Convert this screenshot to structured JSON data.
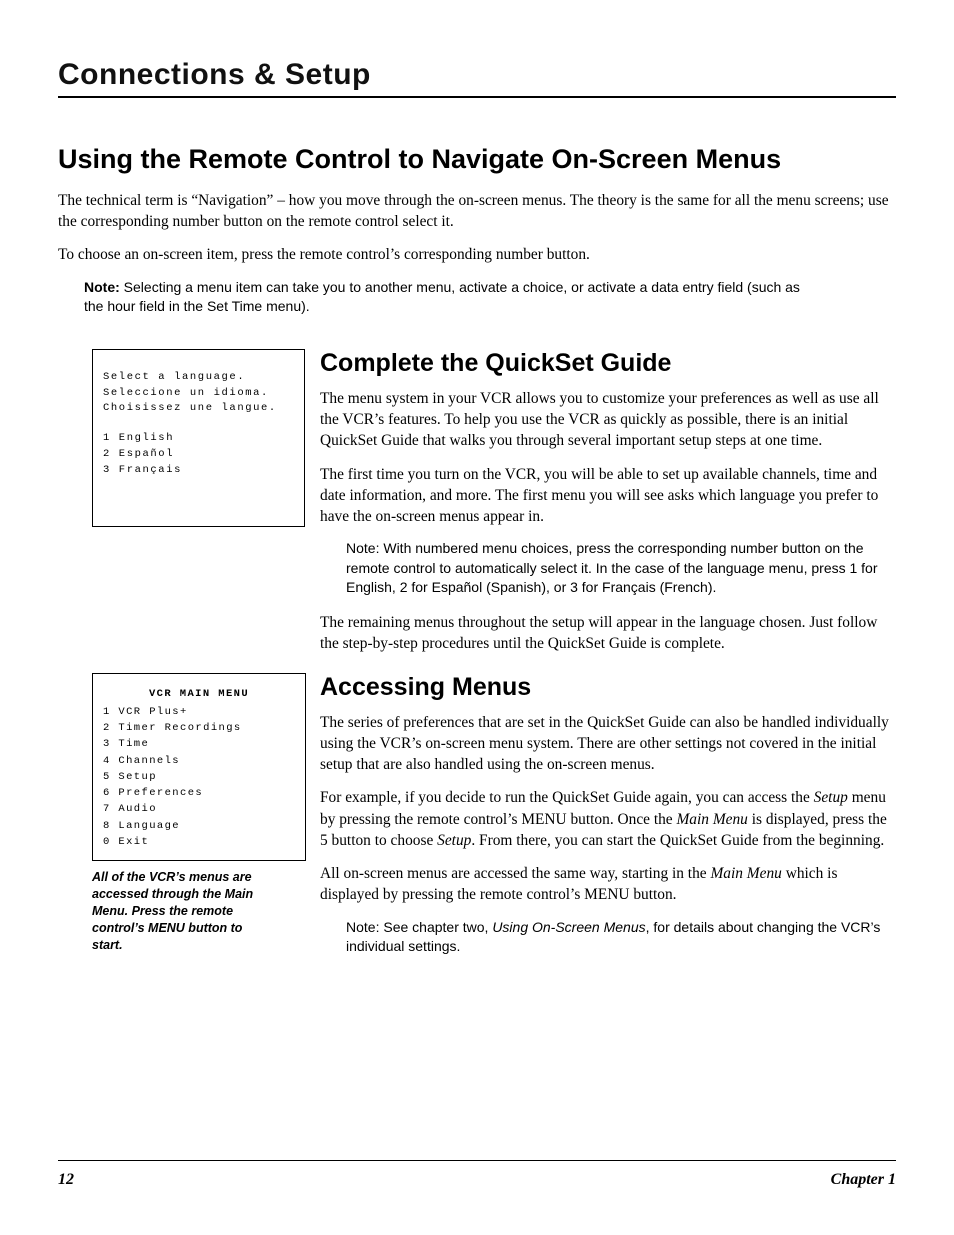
{
  "chapter_title": "Connections & Setup",
  "section1": {
    "title": "Using the Remote Control to Navigate On-Screen Menus",
    "para1": "The technical term is “Navigation” – how you move through the on-screen menus. The theory is the same for all the menu screens; use the corresponding number button on the remote control select it.",
    "para2": "To choose an on-screen item, press the remote control’s corresponding number button.",
    "note_bold": "Note:",
    "note_text": " Selecting a menu item can take you to another menu, activate a choice, or activate a data entry field (such as the hour field in the Set Time menu)."
  },
  "lang_box": {
    "line1": "Select a language.",
    "line2": "Seleccione un idioma.",
    "line3": "Choisissez une langue.",
    "opt1": "1 English",
    "opt2": "2 Español",
    "opt3": "3 Français"
  },
  "main_menu_box": {
    "title": "VCR MAIN MENU",
    "items": [
      "1 VCR Plus+",
      "2 Timer Recordings",
      "3 Time",
      "4 Channels",
      "5 Setup",
      "6 Preferences",
      "7 Audio",
      "8 Language",
      "0 Exit"
    ]
  },
  "main_menu_caption": "All of the VCR’s menus are accessed through the Main Menu. Press the remote control’s MENU button to start.",
  "quickset": {
    "title": "Complete the QuickSet Guide",
    "para1": "The menu system in your VCR allows you to customize your preferences as well as use all the VCR’s features. To help you use the VCR as quickly as possible, there is an initial QuickSet Guide that walks you through several important setup steps at one time.",
    "para2": "The first time you turn on the VCR, you will be able to set up available channels, time and date information, and more. The first menu you will see asks which language you prefer to have the on-screen menus appear in.",
    "note_bold": "Note",
    "note_text": ": With numbered menu choices, press the corresponding number button on the remote control to automatically select it. In the case of the language menu, press 1 for English, 2 for Español (Spanish), or 3 for Français (French).",
    "para3": "The remaining menus throughout the setup will appear in the language chosen. Just follow the step-by-step procedures until the QuickSet Guide is complete."
  },
  "accessing": {
    "title": "Accessing Menus",
    "para1": "The series of preferences that are set in the QuickSet Guide can also be handled individually using the VCR’s on-screen menu system. There are other settings not covered in the initial setup that are also handled using the on-screen menus.",
    "para2a": "For example, if you decide to run the QuickSet Guide again, you can access the ",
    "para2_i1": "Setup",
    "para2b": " menu by pressing the remote control’s MENU button. Once the ",
    "para2_i2": "Main Menu",
    "para2c": " is displayed, press the 5 button to choose ",
    "para2_i3": "Setup",
    "para2d": ". From there, you can start the QuickSet Guide from the beginning.",
    "para3a": "All on-screen menus are accessed the same way, starting in the ",
    "para3_i1": "Main Menu",
    "para3b": " which is displayed by pressing the remote control’s MENU button.",
    "note_bold": "Note",
    "note_a": ": See chapter two, ",
    "note_i": "Using On-Screen Menus",
    "note_b": ", for details about changing the VCR’s individual settings."
  },
  "footer": {
    "page": "12",
    "chapter": "Chapter 1"
  }
}
